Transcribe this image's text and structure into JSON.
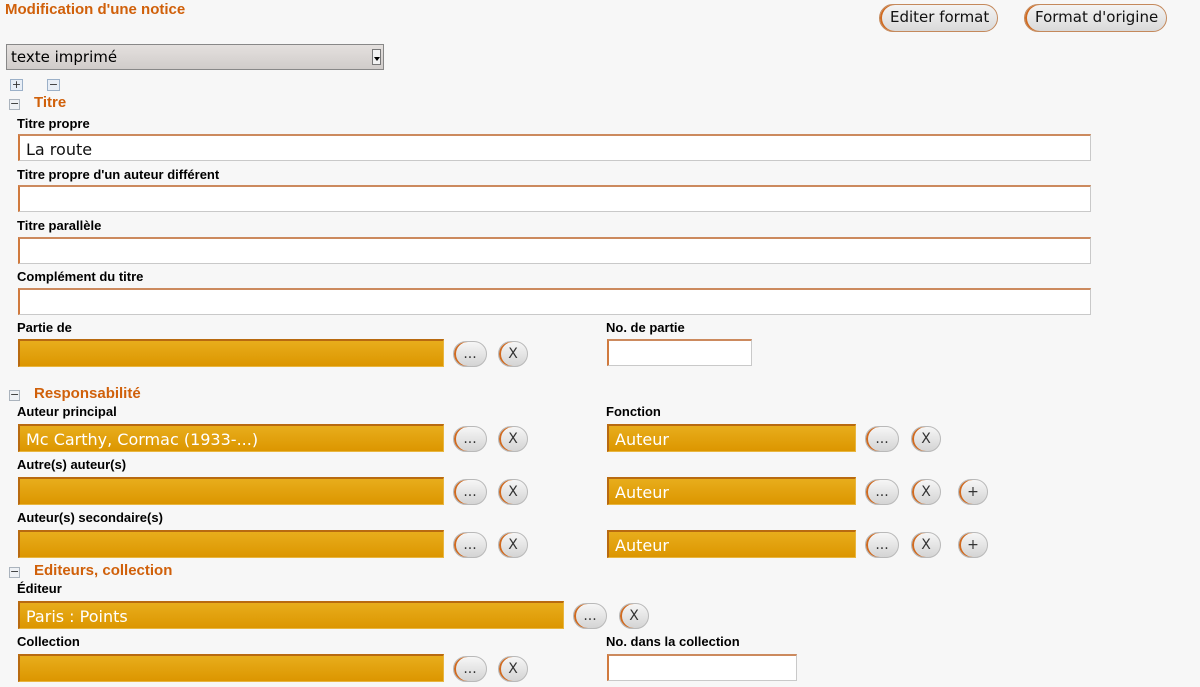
{
  "header": {
    "title": "Modification d'une notice",
    "edit_format_label": "Editer format",
    "original_format_label": "Format d'origine"
  },
  "document_type": {
    "selected": "texte imprimé"
  },
  "tree_controls": {
    "expand_all": "+",
    "collapse_all": "−"
  },
  "sections": {
    "titre": {
      "toggle": "−",
      "title": "Titre",
      "titre_propre_label": "Titre propre",
      "titre_propre_value": "La route",
      "titre_auteur_different_label": "Titre propre d'un auteur différent",
      "titre_auteur_different_value": "",
      "titre_parallele_label": "Titre parallèle",
      "titre_parallele_value": "",
      "complement_label": "Complément du titre",
      "complement_value": "",
      "partie_de_label": "Partie de",
      "partie_de_value": "",
      "no_partie_label": "No. de partie",
      "no_partie_value": ""
    },
    "responsabilite": {
      "toggle": "−",
      "title": "Responsabilité",
      "auteur_principal_label": "Auteur principal",
      "auteur_principal_value": "Mc Carthy, Cormac (1933-...)",
      "fonction_label": "Fonction",
      "fonction_principal_value": "Auteur",
      "autres_auteurs_label": "Autre(s) auteur(s)",
      "autres_auteurs_value": "",
      "fonction_autres_value": "Auteur",
      "auteurs_secondaires_label": "Auteur(s) secondaire(s)",
      "auteurs_secondaires_value": "",
      "fonction_secondaires_value": "Auteur"
    },
    "editeurs": {
      "toggle": "−",
      "title": "Editeurs, collection",
      "editeur_label": "Éditeur",
      "editeur_value": "Paris : Points",
      "collection_label": "Collection",
      "collection_value": "",
      "no_collection_label": "No. dans la collection",
      "no_collection_value": ""
    }
  },
  "buttons": {
    "select": "...",
    "clear": "X",
    "add": "+"
  },
  "colors": {
    "accent": "#d0600a",
    "field_orange": "#dc9600"
  }
}
